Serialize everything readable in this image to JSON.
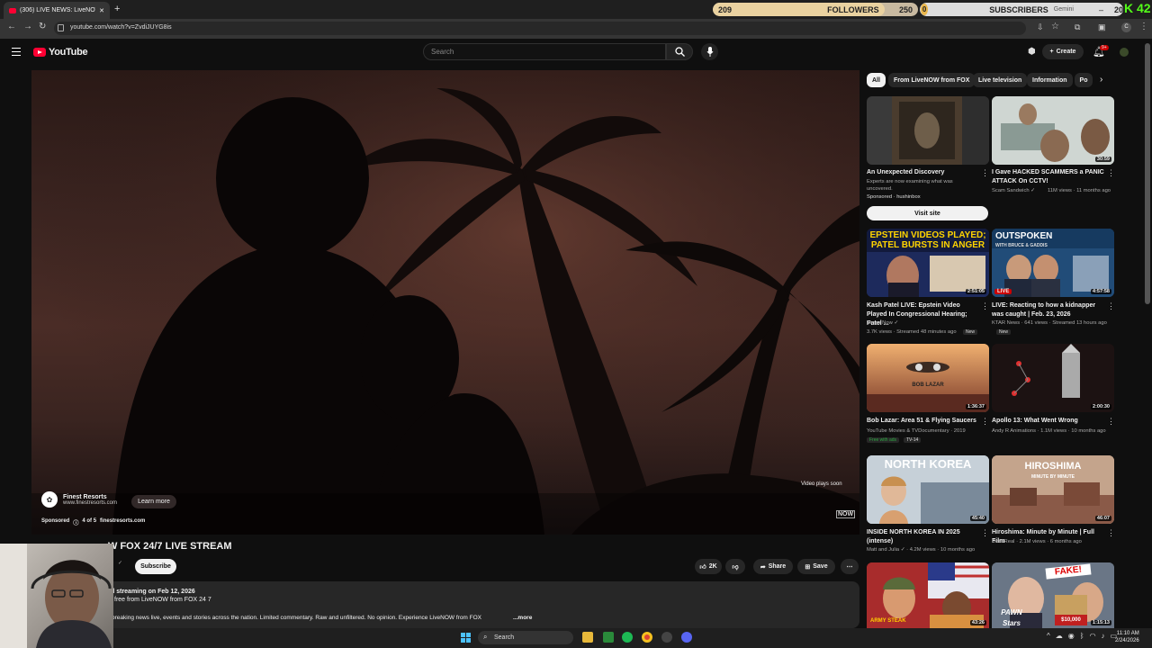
{
  "browser": {
    "tab_title": "(306) LIVE NEWS: LiveNOW FO",
    "url": "youtube.com/watch?v=ZvdiJUYG8is"
  },
  "overlay": {
    "followers_current": "209",
    "followers_label": "FOLLOWERS",
    "followers_goal": "250",
    "followers_progress": 0.836,
    "subscribers_current": "0",
    "subscribers_label": "SUBSCRIBERS",
    "subscribers_goal": "20",
    "gemini_label": "Gemini",
    "kick_count": "42"
  },
  "youtube": {
    "logo_text": "YouTube",
    "search_placeholder": "Search",
    "create_label": "Create",
    "notif_badge": "9+"
  },
  "player": {
    "ad_name": "Finest Resorts",
    "ad_url": "www.finestresorts.com",
    "learn_more": "Learn more",
    "sponsored": "Sponsored",
    "ad_count": "4 of 5",
    "ad_domain": "finestresorts.com",
    "plays_soon": "Video plays soon",
    "watermark": "NOW"
  },
  "video": {
    "title": "W FOX 24/7 LIVE STREAM",
    "channel_fragment": "X",
    "subscribe_label": "Subscribe",
    "likes": "2K",
    "share_label": "Share",
    "save_label": "Save",
    "desc_date": "d streaming on Feb 12, 2026",
    "desc_line": "free from LiveNOW from FOX 24 7",
    "desc_text": "breaking news live, events and stories across the nation. Limited commentary. Raw and unfiltered. No opinion. Experience LiveNOW from FOX",
    "desc_more": "...more"
  },
  "chips": [
    "All",
    "From LiveNOW from FOX",
    "Live television",
    "Information",
    "Po"
  ],
  "sidebar": {
    "visit_site": "Visit site",
    "cards": [
      {
        "title": "An Unexpected Discovery",
        "meta1": "Experts are now examining what was",
        "meta2": "uncovered.",
        "meta3": "Sponsored · hushinbox",
        "duration": ""
      },
      {
        "title": "I Gave HACKED SCAMMERS a PANIC ATTACK On CCTV!",
        "meta1": "Scam Sandwich ✓",
        "meta2": "11M views · 11 months ago",
        "duration": "30:59"
      },
      {
        "title": "Kash Patel LIVE: Epstein Video Played In Congressional Hearing; Patel ...",
        "meta1": "Times Now ✓",
        "meta2": "3.7K views · Streamed 48 minutes ago",
        "badge": "New",
        "duration": "2:51:05",
        "thumb_text_1": "EPSTEIN VIDEOS PLAYED;",
        "thumb_text_2": "PATEL BURSTS IN ANGER"
      },
      {
        "title": "LIVE: Reacting to how a kidnapper was caught | Feb. 23, 2026",
        "meta1": "KTAR News · 641 views · Streamed 13 hours ago",
        "badge": "New",
        "duration": "4:57:58",
        "thumb_text_1": "OUTSPOKEN",
        "thumb_text_2": "WITH BRUCE & GADDIS",
        "live_label": "LIVE"
      },
      {
        "title": "Bob Lazar: Area 51 & Flying Saucers",
        "meta1": "YouTube Movies & TVDocumentary · 2019",
        "meta2": "Free with ads",
        "badge": "TV-14",
        "duration": "1:36:37",
        "thumb_text_1": "BOB LAZAR"
      },
      {
        "title": "Apollo 13: What Went Wrong",
        "meta1": "Andy R Animations · 1.1M views · 10 months ago",
        "duration": "2:00:30"
      },
      {
        "title": "INSIDE NORTH KOREA IN 2025 (intense)",
        "meta1": "Matt and Julia ✓ · 4.2M views · 10 months ago",
        "duration": "45:40",
        "thumb_text_1": "NORTH KOREA"
      },
      {
        "title": "Hiroshima: Minute by Minute | Full Film",
        "meta1": "DocuReal · 2.1M views · 6 months ago",
        "duration": "46:07",
        "thumb_text_1": "HIROSHIMA",
        "thumb_text_2": "MINUTE BY MINUTE"
      },
      {
        "title": "",
        "duration": "43:26",
        "thumb_text_1": "ARMY STEAK"
      },
      {
        "title": "",
        "duration": "1:15:13",
        "thumb_text_1": "FAKE!",
        "thumb_text_2": "PAWN Stars",
        "thumb_text_3": "$10,000"
      }
    ]
  },
  "taskbar": {
    "search_label": "Search",
    "time": "11:10 AM",
    "date": "2/24/2026"
  }
}
